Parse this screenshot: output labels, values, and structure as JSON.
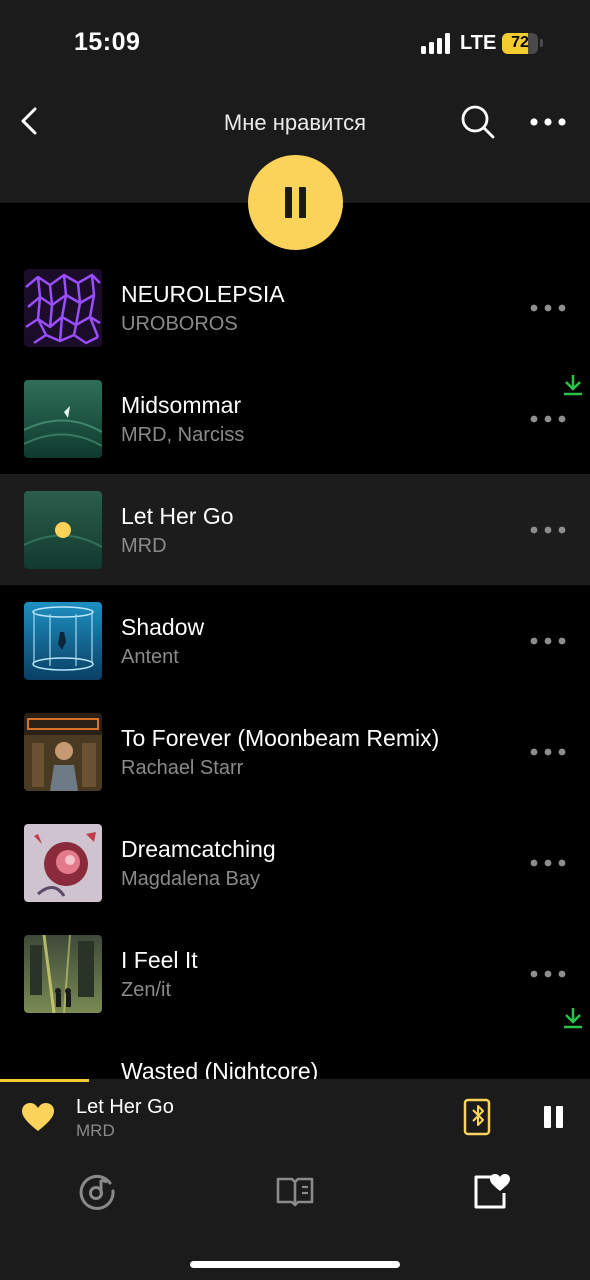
{
  "status_bar": {
    "time": "15:09",
    "network": "LTE",
    "battery_percent": "72",
    "battery_level": 0.72,
    "icons": [
      "signal-icon",
      "battery-icon"
    ]
  },
  "header": {
    "title": "Мне нравится",
    "icons": [
      "back-icon",
      "search-icon",
      "more-icon",
      "pause-icon"
    ],
    "accent_color": "#fcd35a"
  },
  "tracks": [
    {
      "title": "NEUROLEPSIA",
      "artist": "UROBOROS",
      "downloaded": false,
      "active": false
    },
    {
      "title": "Midsommar",
      "artist": "MRD, Narciss",
      "downloaded": true,
      "active": false
    },
    {
      "title": "Let Her Go",
      "artist": "MRD",
      "downloaded": false,
      "active": true
    },
    {
      "title": "Shadow",
      "artist": "Antent",
      "downloaded": false,
      "active": false
    },
    {
      "title": "To Forever (Moonbeam Remix)",
      "artist": "Rachael Starr",
      "downloaded": false,
      "active": false
    },
    {
      "title": "Dreamcatching",
      "artist": "Magdalena Bay",
      "downloaded": false,
      "active": false
    },
    {
      "title": "I Feel It",
      "artist": "Zen/it",
      "downloaded": false,
      "active": false
    },
    {
      "title": "Wasted (Nightcore)",
      "artist": "",
      "downloaded": true,
      "active": false
    }
  ],
  "now_playing": {
    "title": "Let Her Go",
    "artist": "MRD",
    "progress": 0.15,
    "liked": true,
    "playing": true
  },
  "tab_bar": {
    "tabs": [
      "music-icon",
      "library-icon",
      "favorites-icon"
    ]
  },
  "colors": {
    "accent": "#fcd35a",
    "download": "#2bc44a",
    "background": "#000000",
    "panel": "#1b1b1b"
  }
}
